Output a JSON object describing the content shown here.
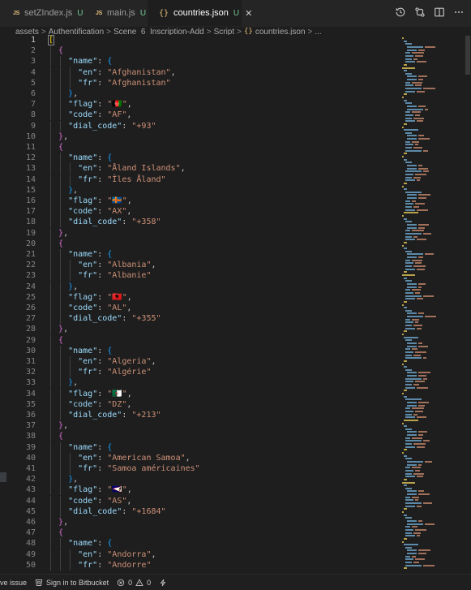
{
  "tabs": [
    {
      "label": "setZIndex.js",
      "status": "U",
      "icon": "js-file-icon",
      "icon_text": "JS",
      "active": false
    },
    {
      "label": "main.js",
      "status": "U",
      "icon": "js-file-icon",
      "icon_text": "JS",
      "active": false
    },
    {
      "label": "countries.json",
      "status": "U",
      "icon": "json-file-icon",
      "icon_text": "{}",
      "active": true
    }
  ],
  "tab_close_glyph": "✕",
  "breadcrumb": {
    "items": [
      "assets",
      "Authentification",
      "Scene_6_Inscription-Add",
      "Script",
      "countries.json",
      "..."
    ],
    "separator": ">",
    "json_glyph": "{}"
  },
  "editor": {
    "language": "json",
    "current_line": 1,
    "lines": [
      {
        "n": "1",
        "text": "["
      },
      {
        "n": "2",
        "text": "  {"
      },
      {
        "n": "3",
        "text": "    \"name\": {"
      },
      {
        "n": "4",
        "text": "      \"en\": \"Afghanistan\","
      },
      {
        "n": "5",
        "text": "      \"fr\": \"Afghanistan\""
      },
      {
        "n": "6",
        "text": "    },"
      },
      {
        "n": "7",
        "text": "    \"flag\": \"🇦🇫\","
      },
      {
        "n": "8",
        "text": "    \"code\": \"AF\","
      },
      {
        "n": "9",
        "text": "    \"dial_code\": \"+93\""
      },
      {
        "n": "10",
        "text": "  },"
      },
      {
        "n": "11",
        "text": "  {"
      },
      {
        "n": "12",
        "text": "    \"name\": {"
      },
      {
        "n": "13",
        "text": "      \"en\": \"Åland Islands\","
      },
      {
        "n": "14",
        "text": "      \"fr\": \"Îles Åland\""
      },
      {
        "n": "15",
        "text": "    },"
      },
      {
        "n": "16",
        "text": "    \"flag\": \"🇦🇽\","
      },
      {
        "n": "17",
        "text": "    \"code\": \"AX\","
      },
      {
        "n": "18",
        "text": "    \"dial_code\": \"+358\""
      },
      {
        "n": "19",
        "text": "  },"
      },
      {
        "n": "20",
        "text": "  {"
      },
      {
        "n": "21",
        "text": "    \"name\": {"
      },
      {
        "n": "22",
        "text": "      \"en\": \"Albania\","
      },
      {
        "n": "23",
        "text": "      \"fr\": \"Albanie\""
      },
      {
        "n": "24",
        "text": "    },"
      },
      {
        "n": "25",
        "text": "    \"flag\": \"🇦🇱\","
      },
      {
        "n": "26",
        "text": "    \"code\": \"AL\","
      },
      {
        "n": "27",
        "text": "    \"dial_code\": \"+355\""
      },
      {
        "n": "28",
        "text": "  },"
      },
      {
        "n": "29",
        "text": "  {"
      },
      {
        "n": "30",
        "text": "    \"name\": {"
      },
      {
        "n": "31",
        "text": "      \"en\": \"Algeria\","
      },
      {
        "n": "32",
        "text": "      \"fr\": \"Algérie\""
      },
      {
        "n": "33",
        "text": "    },"
      },
      {
        "n": "34",
        "text": "    \"flag\": \"🇩🇿\","
      },
      {
        "n": "35",
        "text": "    \"code\": \"DZ\","
      },
      {
        "n": "36",
        "text": "    \"dial_code\": \"+213\""
      },
      {
        "n": "37",
        "text": "  },"
      },
      {
        "n": "38",
        "text": "  {"
      },
      {
        "n": "39",
        "text": "    \"name\": {"
      },
      {
        "n": "40",
        "text": "      \"en\": \"American Samoa\","
      },
      {
        "n": "41",
        "text": "      \"fr\": \"Samoa américaines\""
      },
      {
        "n": "42",
        "text": "    },"
      },
      {
        "n": "43",
        "text": "    \"flag\": \"🇦🇸\","
      },
      {
        "n": "44",
        "text": "    \"code\": \"AS\","
      },
      {
        "n": "45",
        "text": "    \"dial_code\": \"+1684\""
      },
      {
        "n": "46",
        "text": "  },"
      },
      {
        "n": "47",
        "text": "  {"
      },
      {
        "n": "48",
        "text": "    \"name\": {"
      },
      {
        "n": "49",
        "text": "      \"en\": \"Andorra\","
      },
      {
        "n": "50",
        "text": "      \"fr\": \"Andorre\""
      }
    ]
  },
  "statusbar": {
    "left_fragment": "ve issue",
    "bitbucket": "Sign in to Bitbucket",
    "errors": "0",
    "warnings": "0"
  },
  "colors": {
    "background": "#1e1e1e",
    "key": "#9cdcfe",
    "string": "#ce9178",
    "bracket_level_1": "#ffd700",
    "bracket_level_2": "#da70d6",
    "bracket_level_3": "#179fff",
    "untracked_status": "#73c991"
  },
  "actions": [
    "history-icon",
    "compare-changes-icon",
    "split-editor-icon",
    "more-actions-icon"
  ]
}
